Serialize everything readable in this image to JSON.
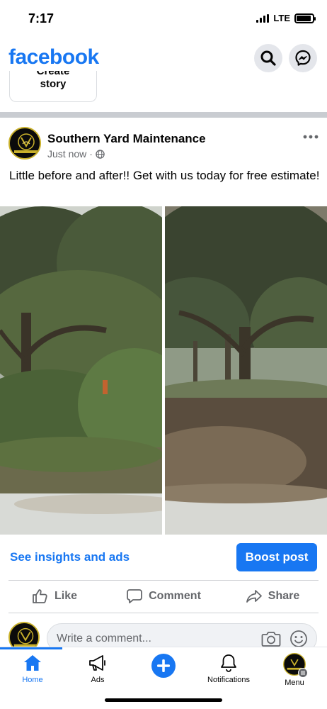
{
  "status_bar": {
    "time": "7:17",
    "network": "LTE"
  },
  "header": {
    "logo": "facebook"
  },
  "stories": {
    "create_line1": "Create",
    "create_line2": "story"
  },
  "post": {
    "page_name": "Southern Yard Maintenance",
    "avatar_caption": "SOUTHERN YARD MAINTENANCE",
    "timestamp": "Just now",
    "separator": "·",
    "text": "Little before and after!! Get with us today for free estimate!",
    "insights_label": "See insights and ads",
    "boost_label": "Boost post",
    "actions": {
      "like": "Like",
      "comment": "Comment",
      "share": "Share"
    }
  },
  "comment": {
    "placeholder": "Write a comment..."
  },
  "tabs": [
    {
      "label": "Home"
    },
    {
      "label": "Ads"
    },
    {
      "label": ""
    },
    {
      "label": "Notifications"
    },
    {
      "label": "Menu"
    }
  ],
  "colors": {
    "brand": "#1877f2",
    "secondary_text": "#65676b",
    "divider": "#c9ccd1"
  },
  "icons": [
    "search-icon",
    "messenger-icon",
    "more-icon",
    "globe-icon",
    "like-icon",
    "comment-icon",
    "share-icon",
    "camera-icon",
    "emoji-icon",
    "home-icon",
    "megaphone-icon",
    "create-icon",
    "bell-icon"
  ]
}
